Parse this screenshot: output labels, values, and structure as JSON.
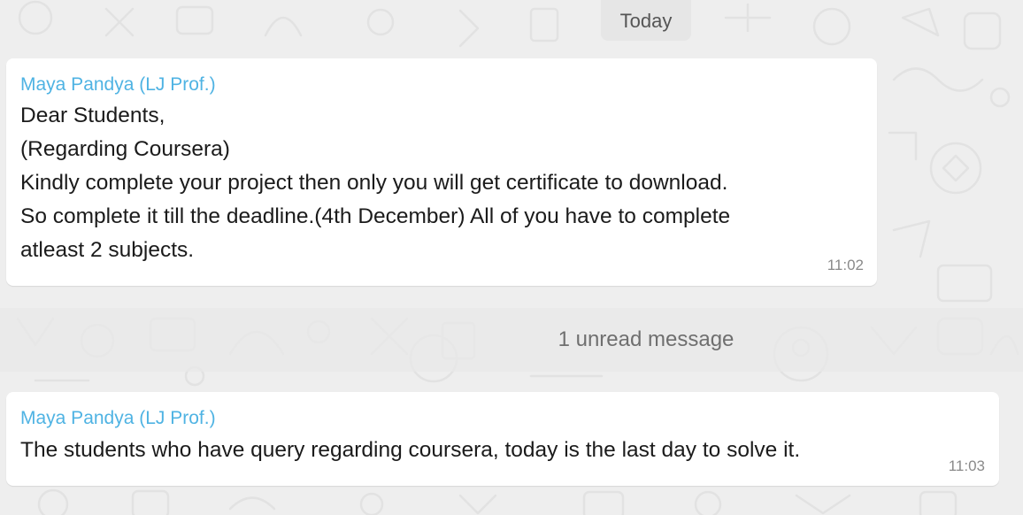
{
  "date_divider": "Today",
  "messages": [
    {
      "sender": "Maya Pandya (LJ Prof.)",
      "lines": [
        "Dear Students,",
        "(Regarding Coursera)",
        "Kindly complete your project then only you will get certificate to download.",
        "So complete it till the deadline.(4th December) All of you have to complete",
        "atleast 2 subjects."
      ],
      "time": "11:02"
    },
    {
      "sender": "Maya Pandya (LJ Prof.)",
      "lines": [
        "The students who have query regarding coursera, today is the last day to solve it."
      ],
      "time": "11:03"
    }
  ],
  "unread_divider": "1 unread message",
  "colors": {
    "sender": "#4fb3e3",
    "background": "#eeeeee",
    "bubble": "#ffffff"
  }
}
